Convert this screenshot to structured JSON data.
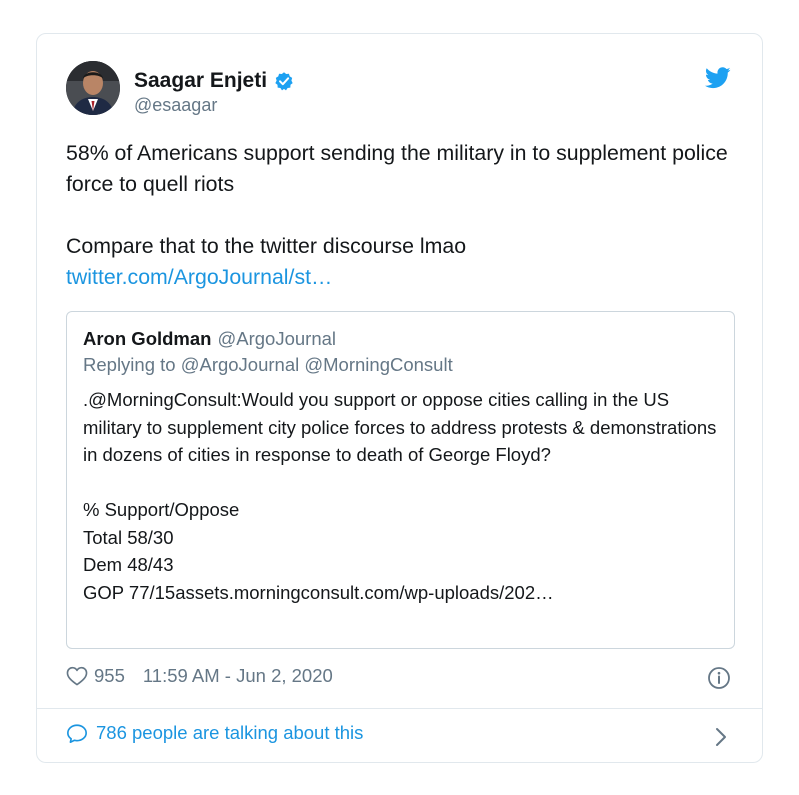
{
  "tweet": {
    "author_name": "Saagar Enjeti",
    "author_handle": "@esaagar",
    "text_line1": "58% of Americans support sending the military in to supplement police force to quell riots",
    "text_line2": "Compare that to the twitter discourse lmao",
    "link_text": "twitter.com/ArgoJournal/st…",
    "likes": "955",
    "timestamp": "11:59 AM - Jun 2, 2020",
    "talking": "786 people are talking about this"
  },
  "quoted": {
    "author_name": "Aron Goldman",
    "author_handle": "@ArgoJournal",
    "replying_to": "Replying to @ArgoJournal @MorningConsult",
    "question": ".@MorningConsult:Would you support or oppose cities calling in the US military to supplement city police forces to address protests & demonstrations in dozens of cities in response to death of George Floyd?",
    "stats": [
      "% Support/Oppose",
      "Total 58/30",
      "Dem 48/43",
      "GOP 77/15assets.morningconsult.com/wp-uploads/202…"
    ]
  },
  "icons": {
    "verified": "verified-badge-icon",
    "logo": "twitter-bird-icon",
    "like": "heart-icon",
    "info": "info-icon",
    "comment": "speech-bubble-icon",
    "chevron": "chevron-right-icon"
  },
  "colors": {
    "accent": "#1da1f2",
    "link": "#1b95e0",
    "secondary_text": "#657786",
    "border": "#e1e8ed"
  }
}
